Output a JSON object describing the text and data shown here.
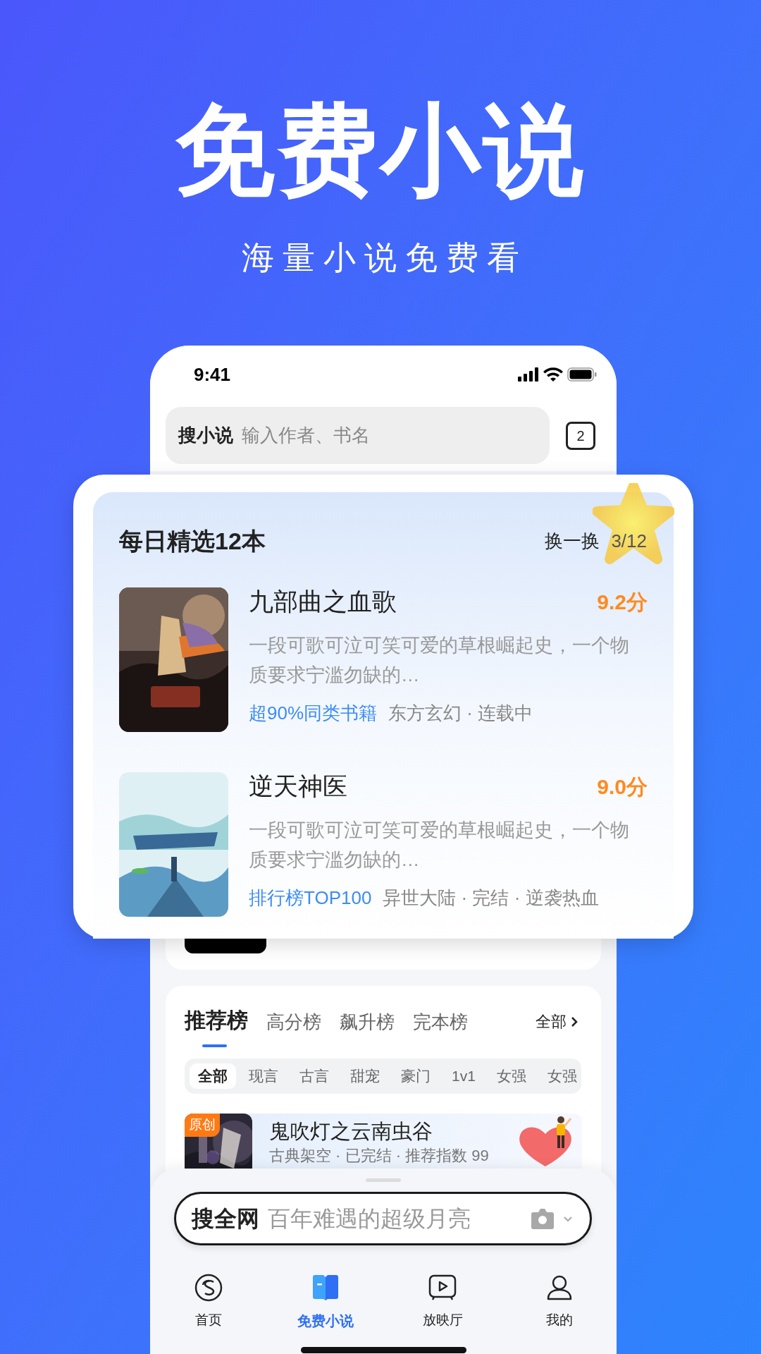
{
  "promo": {
    "title": "免费小说",
    "subtitle": "海量小说免费看"
  },
  "status_bar": {
    "time": "9:41"
  },
  "search": {
    "label": "搜小说",
    "placeholder": "输入作者、书名",
    "tab_count": "2"
  },
  "daily_picks": {
    "title": "每日精选12本",
    "refresh": "换一换",
    "page": "3/12",
    "books": [
      {
        "title": "九部曲之血歌",
        "score": "9.2分",
        "description": "一段可歌可泣可笑可爱的草根崛起史，一个物质要求宁滥勿缺的…",
        "highlight": "超90%同类书籍",
        "tags": "东方玄幻 · 连载中"
      },
      {
        "title": "逆天神医",
        "score": "9.0分",
        "description": "一段可歌可泣可笑可爱的草根崛起史，一个物质要求宁滥勿缺的…",
        "highlight": "排行榜TOP100",
        "tags": "异世大陆 · 完结 · 逆袭热血"
      }
    ]
  },
  "ranking": {
    "tabs": [
      {
        "label": "推荐榜",
        "selected": true
      },
      {
        "label": "高分榜",
        "selected": false
      },
      {
        "label": "飙升榜",
        "selected": false
      },
      {
        "label": "完本榜",
        "selected": false
      }
    ],
    "all_link": "全部",
    "categories": [
      {
        "label": "全部",
        "selected": true
      },
      {
        "label": "现言",
        "selected": false
      },
      {
        "label": "古言",
        "selected": false
      },
      {
        "label": "甜宠",
        "selected": false
      },
      {
        "label": "豪门",
        "selected": false
      },
      {
        "label": "1v1",
        "selected": false
      },
      {
        "label": "女强",
        "selected": false
      },
      {
        "label": "女强",
        "selected": false
      }
    ],
    "books": [
      {
        "badge": "原创",
        "title": "鬼吹灯之云南虫谷",
        "meta": "古典架空 · 已完结 · 推荐指数 99"
      }
    ]
  },
  "bottom_search": {
    "label": "搜全网",
    "placeholder": "百年难遇的超级月亮"
  },
  "tab_bar": [
    {
      "kind": "home",
      "label": "首页",
      "selected": false
    },
    {
      "kind": "novel",
      "label": "免费小说",
      "selected": true
    },
    {
      "kind": "theater",
      "label": "放映厅",
      "selected": false
    },
    {
      "kind": "profile",
      "label": "我的",
      "selected": false
    }
  ]
}
